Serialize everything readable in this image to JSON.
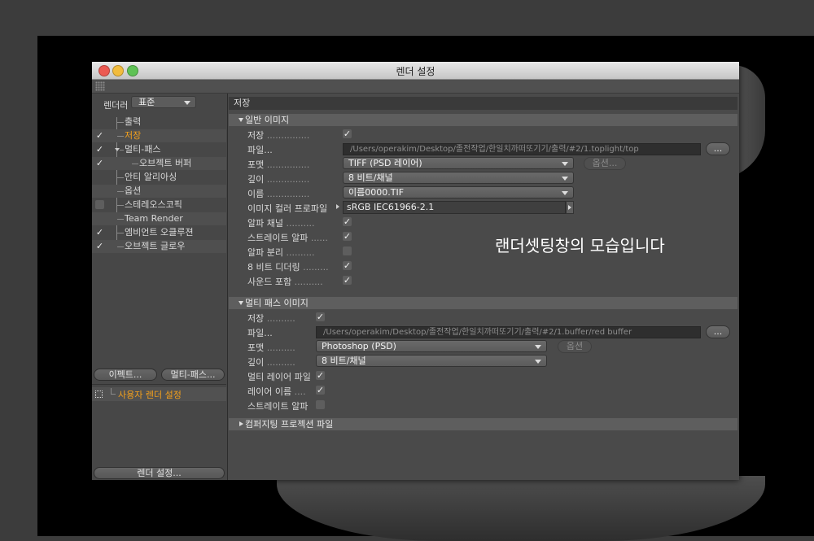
{
  "window": {
    "title": "렌더 설정"
  },
  "overlay_caption": "랜더셋팅창의 모습입니다",
  "left": {
    "renderer_label": "렌더러",
    "renderer_value": "표준",
    "tree": [
      {
        "label": "출력",
        "checked": null,
        "active": false
      },
      {
        "label": "저장",
        "checked": true,
        "active": true
      },
      {
        "label": "멀티-패스",
        "checked": true,
        "active": false
      },
      {
        "label": "오브젝트 버퍼",
        "checked": true,
        "active": false
      },
      {
        "label": "안티 알리아싱",
        "checked": null,
        "active": false
      },
      {
        "label": "옵션",
        "checked": null,
        "active": false
      },
      {
        "label": "스테레오스코픽",
        "checked": false,
        "active": false
      },
      {
        "label": "Team Render",
        "checked": null,
        "active": false
      },
      {
        "label": "엠비언트 오클루젼",
        "checked": true,
        "active": false
      },
      {
        "label": "오브젝트 글로우",
        "checked": true,
        "active": false
      }
    ],
    "effects_button": "이펙트...",
    "multipass_button": "멀티-패스...",
    "custom_setting": "사용자 렌더 설정",
    "render_settings_button": "렌더 설정..."
  },
  "right": {
    "header": "저장",
    "general": {
      "title": "일반 이미지",
      "save_label": "저장",
      "file_label": "파일...",
      "file_path": "/Users/operakim/Desktop/졸전작업/한일치까떠또기기/출력/#2/1.toplight/top",
      "browse_button": "...",
      "format_label": "포맷",
      "format_value": "TIFF (PSD 레이어)",
      "options_button": "옵션...",
      "depth_label": "깊이",
      "depth_value": "8 비트/채널",
      "name_label": "이름",
      "name_value": "이름0000.TIF",
      "profile_label": "이미지 컬러 프로파일",
      "profile_value": "sRGB IEC61966-2.1",
      "alpha_label": "알파 채널",
      "straight_alpha_label": "스트레이트 알파",
      "separate_alpha_label": "알파 분리",
      "dither_label": "8 비트 디더링",
      "sound_label": "사운드 포함"
    },
    "multipass": {
      "title": "멀티 패스 이미지",
      "save_label": "저장",
      "file_label": "파일...",
      "file_path": "/Users/operakim/Desktop/졸전작업/한일치까떠또기기/출력/#2/1.buffer/red buffer",
      "browse_button": "...",
      "format_label": "포맷",
      "format_value": "Photoshop (PSD)",
      "options_button": "옵션",
      "depth_label": "깊이",
      "depth_value": "8 비트/채널",
      "multilayer_label": "멀티 레이어 파일",
      "layer_name_label": "레이어 이름",
      "straight_alpha_label": "스트레이트 알파"
    },
    "compositing": {
      "title": "컴퍼지팅 프로젝션 파일"
    }
  }
}
